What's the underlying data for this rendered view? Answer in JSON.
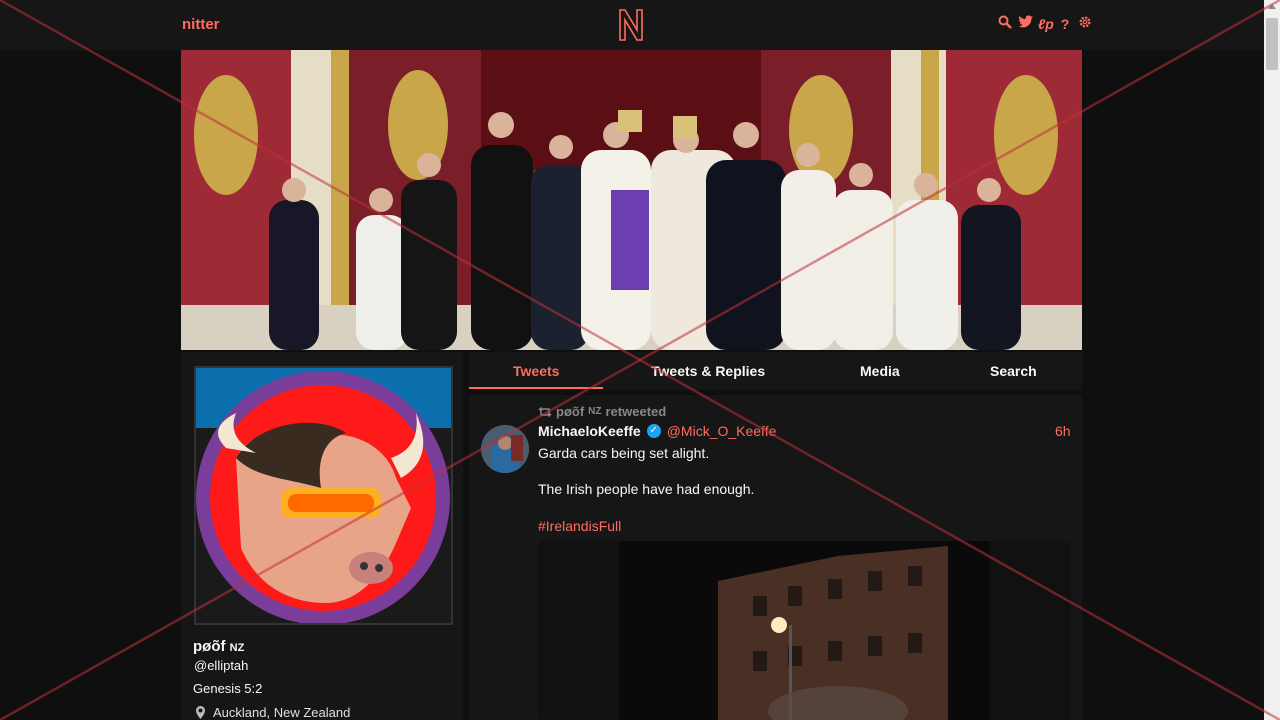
{
  "navbar": {
    "brand": "nitter",
    "logo_letter": "N",
    "icons": [
      "search-icon",
      "twitter-bird-icon",
      "rss-icon",
      "help-icon",
      "gear-icon"
    ],
    "accent_color": "#ff6c60"
  },
  "tabs": [
    {
      "label": "Tweets",
      "active": true
    },
    {
      "label": "Tweets & Replies",
      "active": false
    },
    {
      "label": "Media",
      "active": false
    },
    {
      "label": "Search",
      "active": false
    }
  ],
  "profile": {
    "fullname": "pøõf",
    "flag": "NZ",
    "username": "@elliptah",
    "bio": "Genesis 5:2",
    "location": "Auckland, New Zealand"
  },
  "tweet": {
    "retweet_by": "pøõf",
    "retweet_flag": "NZ",
    "retweet_label": "retweeted",
    "fullname": "MichaeloKeeffe",
    "username": "@Mick_O_Keeffe",
    "time": "6h",
    "line1": "Garda cars being set alight.",
    "line2": "The Irish people have had enough.",
    "hashtag": "#IrelandisFull"
  }
}
